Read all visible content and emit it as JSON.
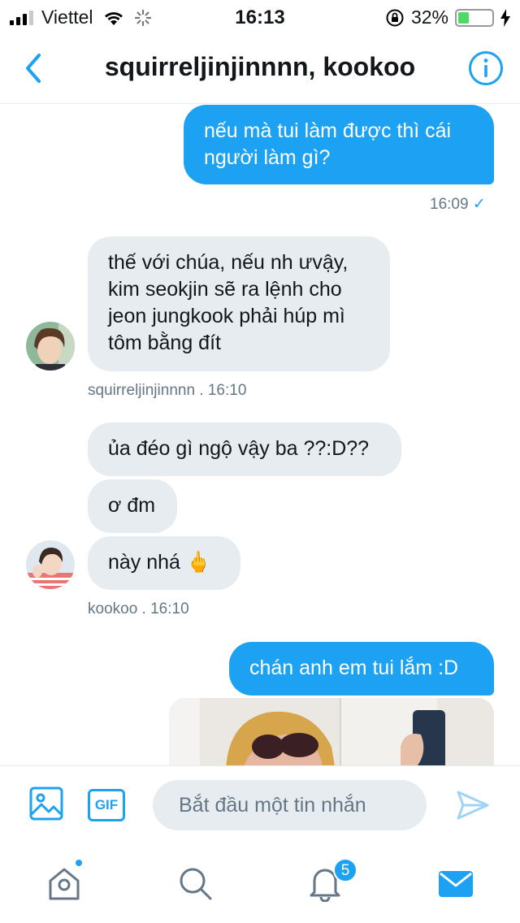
{
  "status_bar": {
    "carrier": "Viettel",
    "time": "16:13",
    "battery_percent": "32%",
    "battery_level": 0.32,
    "icons": [
      "signal-icon",
      "wifi-icon",
      "loading-icon",
      "orientation-lock-icon",
      "battery-icon",
      "charging-icon"
    ]
  },
  "header": {
    "title": "squirreljinjinnnn, kookoo",
    "icons": [
      "back-chevron-icon",
      "info-icon"
    ]
  },
  "messages": [
    {
      "direction": "out",
      "text": "nếu mà tui làm được thì cái người làm gì?"
    },
    {
      "direction": "out_meta",
      "time": "16:09",
      "status": "✓"
    },
    {
      "direction": "in",
      "sender": "squirreljinjinnnn",
      "text": "thế với chúa, nếu nh ưvậy, kim seokjin sẽ ra lệnh cho jeon jungkook phải húp mì tôm bằng đít"
    },
    {
      "direction": "in_meta",
      "label": "squirreljinjinnnn  . 16:10"
    },
    {
      "direction": "in",
      "sender": "kookoo",
      "text": "ủa đéo gì ngộ vậy ba ??:D??"
    },
    {
      "direction": "in",
      "sender": "kookoo",
      "text": "ơ đm"
    },
    {
      "direction": "in",
      "sender": "kookoo",
      "text": "này nhá 🖕"
    },
    {
      "direction": "in_meta",
      "label": "kookoo  . 16:10"
    },
    {
      "direction": "out",
      "text": "chán anh em tui lắm :D"
    }
  ],
  "composer": {
    "placeholder": "Bắt đầu một tin nhắn",
    "gif_label": "GIF",
    "icons": [
      "image-icon",
      "send-icon"
    ]
  },
  "tab_bar": {
    "notifications_count": "5",
    "icons": [
      "home-icon",
      "search-icon",
      "notifications-icon",
      "messages-icon"
    ]
  },
  "colors": {
    "accent": "#1da1f2",
    "incoming_bubble": "#e6ecf0",
    "meta_text": "#657786"
  }
}
